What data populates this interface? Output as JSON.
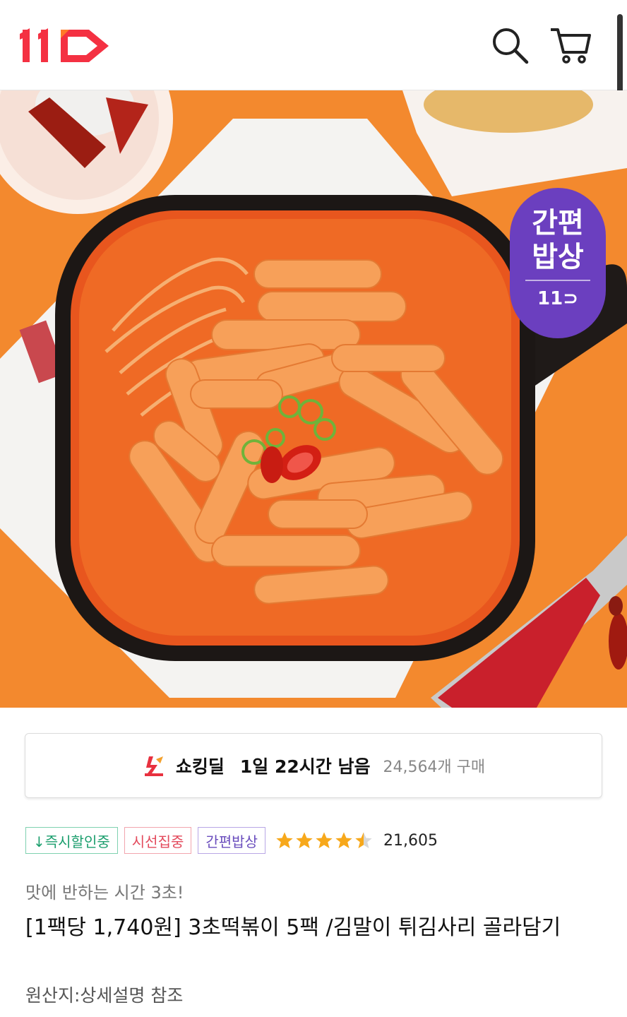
{
  "header": {
    "logo_text": "11",
    "search_icon": "search-icon",
    "cart_icon": "cart-icon"
  },
  "hero": {
    "badge": {
      "line1": "간편",
      "line2": "밥상",
      "logo": "11"
    },
    "carousel": {
      "total_dots": 1,
      "has_video": true
    },
    "colors": {
      "background": "#f3892e",
      "badge": "#6b3fbf"
    }
  },
  "deal": {
    "label": "쇼킹딜",
    "time_left": "1일 22시간 남음",
    "purchases": "24,564개 구매"
  },
  "tags": [
    {
      "label": "↓즉시할인중",
      "color": "#1b9e6d"
    },
    {
      "label": "시선집중",
      "color": "#e34a5c"
    },
    {
      "label": "간편밥상",
      "color": "#6a4dbd"
    }
  ],
  "rating": {
    "stars": 4.5,
    "count": "21,605"
  },
  "product": {
    "subtitle": "맛에 반하는 시간 3초!",
    "title": "[1팩당 1,740원] 3초떡볶이 5팩 /김말이 튀김사리 골라담기",
    "origin": "원산지:상세설명 참조"
  }
}
